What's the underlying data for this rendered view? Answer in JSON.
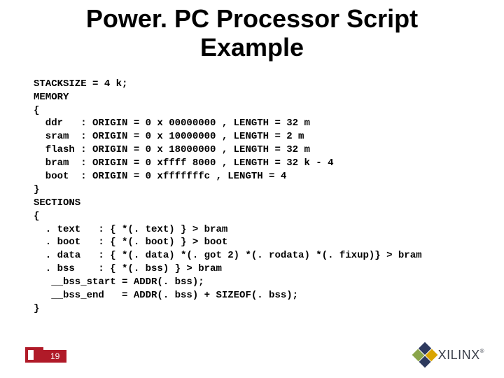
{
  "title_line1": "Power. PC Processor Script",
  "title_line2": "Example",
  "code": {
    "l01": "STACKSIZE = 4 k;",
    "l02": "MEMORY",
    "l03": "{",
    "l04": "  ddr   : ORIGIN = 0 x 00000000 , LENGTH = 32 m",
    "l05": "  sram  : ORIGIN = 0 x 10000000 , LENGTH = 2 m",
    "l06": "  flash : ORIGIN = 0 x 18000000 , LENGTH = 32 m",
    "l07": "  bram  : ORIGIN = 0 xffff 8000 , LENGTH = 32 k - 4",
    "l08": "  boot  : ORIGIN = 0 xfffffffc , LENGTH = 4",
    "l09": "}",
    "l10": "SECTIONS",
    "l11": "{",
    "l12": "  . text   : { *(. text) } > bram",
    "l13": "  . boot   : { *(. boot) } > boot",
    "l14": "  . data   : { *(. data) *(. got 2) *(. rodata) *(. fixup)} > bram",
    "l15": "  . bss    : { *(. bss) } > bram",
    "l16": "   __bss_start = ADDR(. bss);",
    "l17": "   __bss_end   = ADDR(. bss) + SIZEOF(. bss);",
    "l18": "}"
  },
  "page_number": "19",
  "logo_text": "XILINX",
  "reg": "®"
}
